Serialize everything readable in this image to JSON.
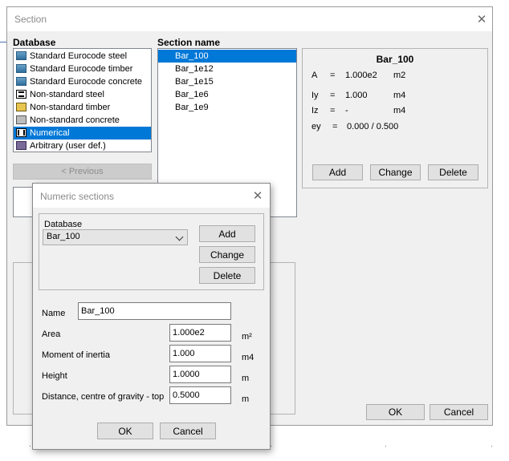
{
  "window": {
    "title": "Section"
  },
  "database": {
    "label": "Database",
    "items": [
      {
        "label": "Standard Eurocode steel",
        "icon": "eurocode-steel-icon"
      },
      {
        "label": "Standard Eurocode timber",
        "icon": "eurocode-timber-icon"
      },
      {
        "label": "Standard Eurocode concrete",
        "icon": "eurocode-concrete-icon"
      },
      {
        "label": "Non-standard steel",
        "icon": "steel-profile-icon"
      },
      {
        "label": "Non-standard timber",
        "icon": "timber-icon"
      },
      {
        "label": "Non-standard concrete",
        "icon": "concrete-icon"
      },
      {
        "label": "Numerical",
        "icon": "numerical-section-icon",
        "selected": true
      },
      {
        "label": "Arbitrary (user def.)",
        "icon": "arbitrary-section-icon"
      }
    ],
    "previous_label": "< Previous"
  },
  "section_name": {
    "label": "Section name",
    "items": [
      {
        "label": "Bar_100",
        "selected": true
      },
      {
        "label": "Bar_1e12"
      },
      {
        "label": "Bar_1e15"
      },
      {
        "label": "Bar_1e6"
      },
      {
        "label": "Bar_1e9"
      }
    ]
  },
  "properties": {
    "title": "Bar_100",
    "rows": [
      {
        "sym": "A",
        "eq": "=",
        "val": "1.000e2",
        "unit": "m2"
      },
      {
        "sym": "Iy",
        "eq": "=",
        "val": "1.000",
        "unit": "m4"
      },
      {
        "sym": "Iz",
        "eq": "=",
        "val": "-",
        "unit": "m4"
      },
      {
        "sym": "ey",
        "eq": "=",
        "val": "0.000 / 0.500",
        "unit": ""
      }
    ],
    "add_label": "Add",
    "change_label": "Change",
    "delete_label": "Delete"
  },
  "footer": {
    "ok_label": "OK",
    "cancel_label": "Cancel"
  },
  "numeric_dialog": {
    "title": "Numeric sections",
    "database_label": "Database",
    "selected": "Bar_100",
    "add_label": "Add",
    "change_label": "Change",
    "delete_label": "Delete",
    "name_label": "Name",
    "name_value": "Bar_100",
    "fields": [
      {
        "label": "Area",
        "value": "1.000e2",
        "unit": "m²"
      },
      {
        "label": "Moment of inertia",
        "value": "1.000",
        "unit": "m4"
      },
      {
        "label": "Height",
        "value": "1.0000",
        "unit": "m"
      },
      {
        "label": "Distance, centre of gravity - top",
        "value": "0.5000",
        "unit": "m"
      }
    ],
    "ok_label": "OK",
    "cancel_label": "Cancel"
  }
}
